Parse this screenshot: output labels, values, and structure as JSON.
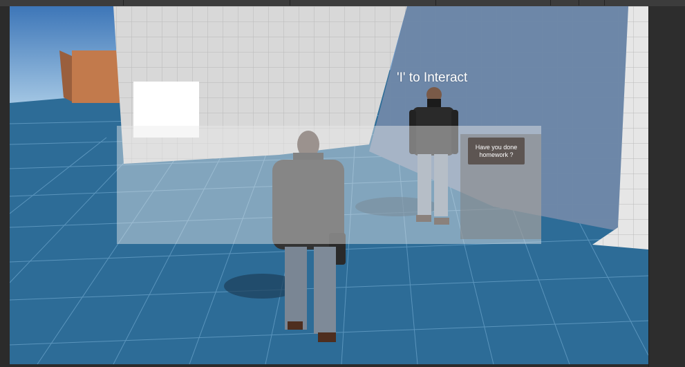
{
  "window": {
    "editor_chrome": "unity-style editor, dark theme"
  },
  "hud": {
    "interact_prompt": "'I' to Interact"
  },
  "dialog": {
    "option_label": "Have you done homework ?"
  },
  "scene": {
    "sky_color": "#4a86c6",
    "floor_color": "#2d6c97",
    "grid_line_color": "#8fc0e0",
    "wall_color": "#d8d8d8",
    "crate_color": "#c27a4c"
  }
}
